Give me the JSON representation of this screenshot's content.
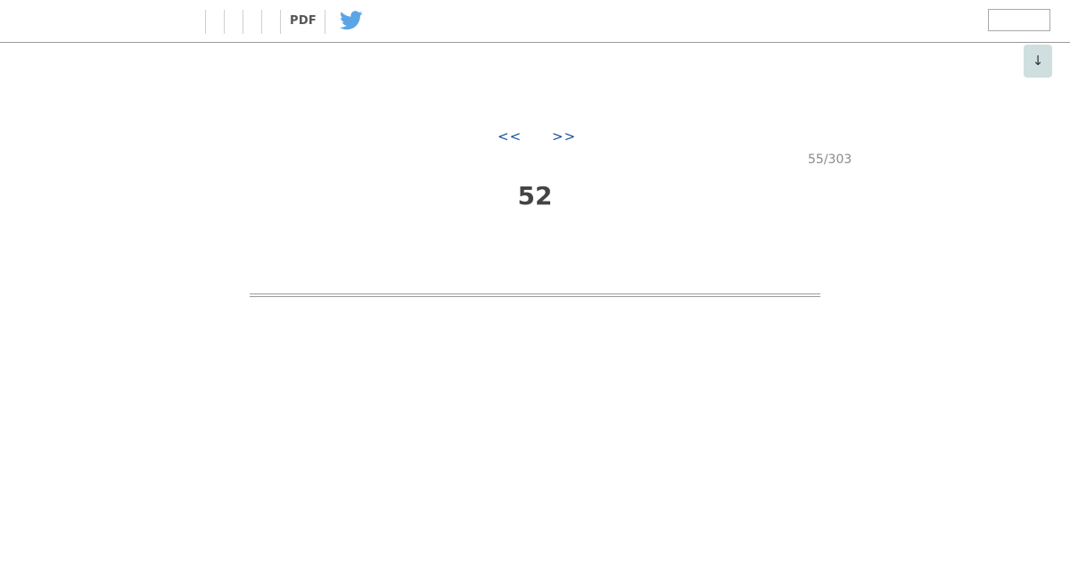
{
  "toolbar": {
    "pdf_label": "PDF",
    "twitter_icon": "twitter-bird-icon",
    "twitter_color": "#5ba4e5",
    "search_value": ""
  },
  "scroll_down": {
    "label": "↓",
    "background": "#cfdfdf"
  },
  "navigation": {
    "prev_label": "<<",
    "next_label": ">>",
    "link_color": "#1a4f99"
  },
  "page": {
    "counter": "55/303",
    "number": "52"
  }
}
